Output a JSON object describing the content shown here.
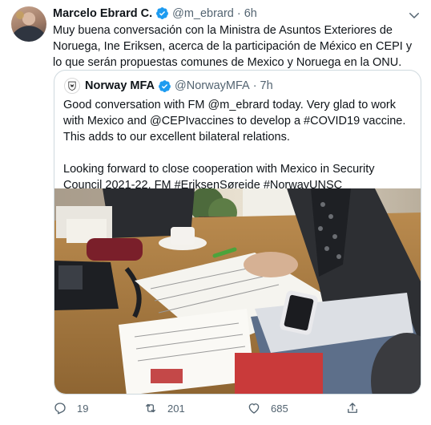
{
  "tweet": {
    "author": {
      "display_name": "Marcelo Ebrard C.",
      "handle": "@m_ebrard",
      "verified": true
    },
    "separator": "·",
    "time": "6h",
    "text": "Muy buena conversación con la Ministra de Asuntos Exteriores de Noruega, Ine Eriksen, acerca de la participación de México en CEPI y lo que serán propuestas comunes de Mexico y Noruega en la ONU.",
    "quoted": {
      "author": {
        "display_name": "Norway MFA",
        "handle": "@NorwayMFA",
        "verified": true
      },
      "separator": "·",
      "time": "7h",
      "text": "Good conversation with FM @m_ebrard today. Very glad to work with Mexico and @CEPIvaccines to develop a #COVID19 vaccine. This adds to our excellent bilateral relations.\n\nLooking forward to close cooperation with Mexico in Security Council 2021-22. FM #EriksenSøreide #NorwayUNSC"
    },
    "actions": {
      "replies": "19",
      "retweets": "201",
      "likes": "685"
    },
    "icons": [
      "verified-icon",
      "caret-down-icon",
      "reply-icon",
      "retweet-icon",
      "like-icon",
      "share-icon"
    ],
    "colors": {
      "verified_blue": "#1d9bf0",
      "text_primary": "#0f1419",
      "text_secondary": "#536471",
      "border": "#cfd9de"
    }
  }
}
